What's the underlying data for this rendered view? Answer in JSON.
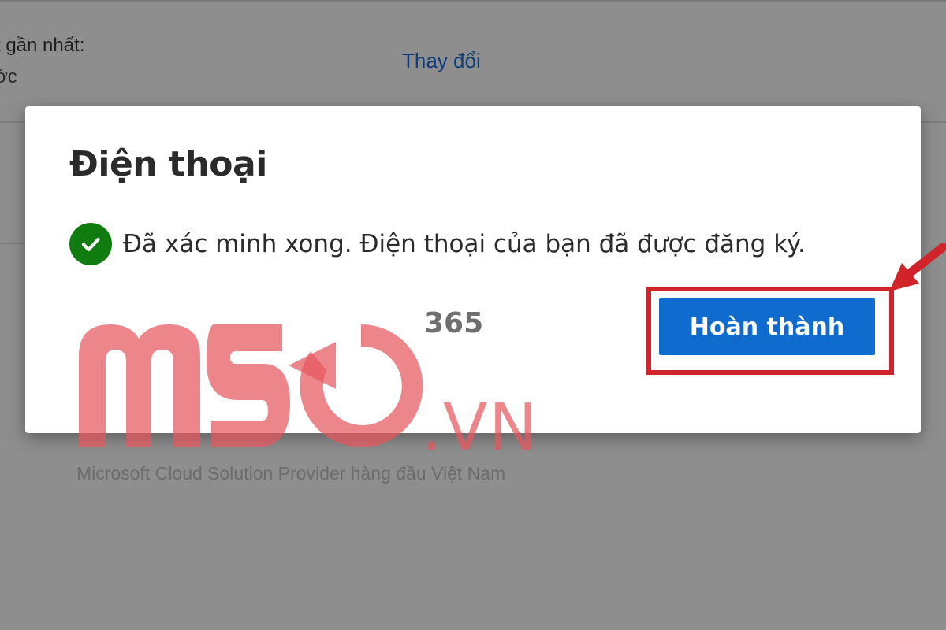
{
  "background": {
    "label": "t gần nhất:",
    "sublabel": "ớc",
    "change_link": "Thay đổi"
  },
  "dialog": {
    "title": "Điện thoại",
    "status_icon": "checkmark-circle-icon",
    "status_text": "Đã xác minh xong. Điện thoại của bạn đã được đăng ký.",
    "done_button": "Hoàn thành"
  },
  "watermark": {
    "logo_text": "MSO",
    "superscript": "365",
    "domain_suffix": ".VN",
    "tagline": "Microsoft Cloud Solution Provider hàng đầu Việt Nam"
  },
  "colors": {
    "accent_button": "#0f6cce",
    "success": "#107c10",
    "highlight": "#d1232a",
    "watermark": "#e5575e"
  }
}
